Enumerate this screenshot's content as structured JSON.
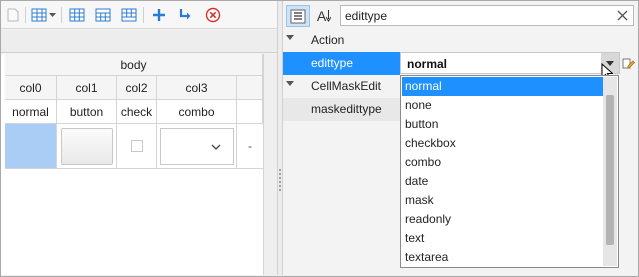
{
  "left_toolbar": {
    "icons": [
      "new-icon",
      "columns-icon",
      "dropdown-arrow-icon",
      "grid-icon",
      "grid-merge-icon",
      "grid-split-icon",
      "add-icon",
      "indent-icon",
      "delete-icon"
    ],
    "accent": "#2b7bd3",
    "delete_color": "#d9342b"
  },
  "grid": {
    "band_header": "body",
    "columns": [
      "col0",
      "col1",
      "col2",
      "col3"
    ],
    "row_labels": [
      "normal",
      "button",
      "check",
      "combo"
    ],
    "trailing_text": "- "
  },
  "right_toolbar": {
    "icons": [
      "categorized-icon",
      "sort-alpha-icon"
    ],
    "sort_label": "A",
    "search": {
      "value": "edittype"
    }
  },
  "properties": {
    "categories": [
      {
        "name": "Action"
      },
      {
        "name": "CellMaskEdit"
      }
    ],
    "rows": [
      {
        "name": "edittype",
        "value": "normal"
      },
      {
        "name": "maskedittype"
      }
    ]
  },
  "dropdown": {
    "options": [
      "normal",
      "none",
      "button",
      "checkbox",
      "combo",
      "date",
      "mask",
      "readonly",
      "text",
      "textarea"
    ],
    "selected": "normal"
  }
}
